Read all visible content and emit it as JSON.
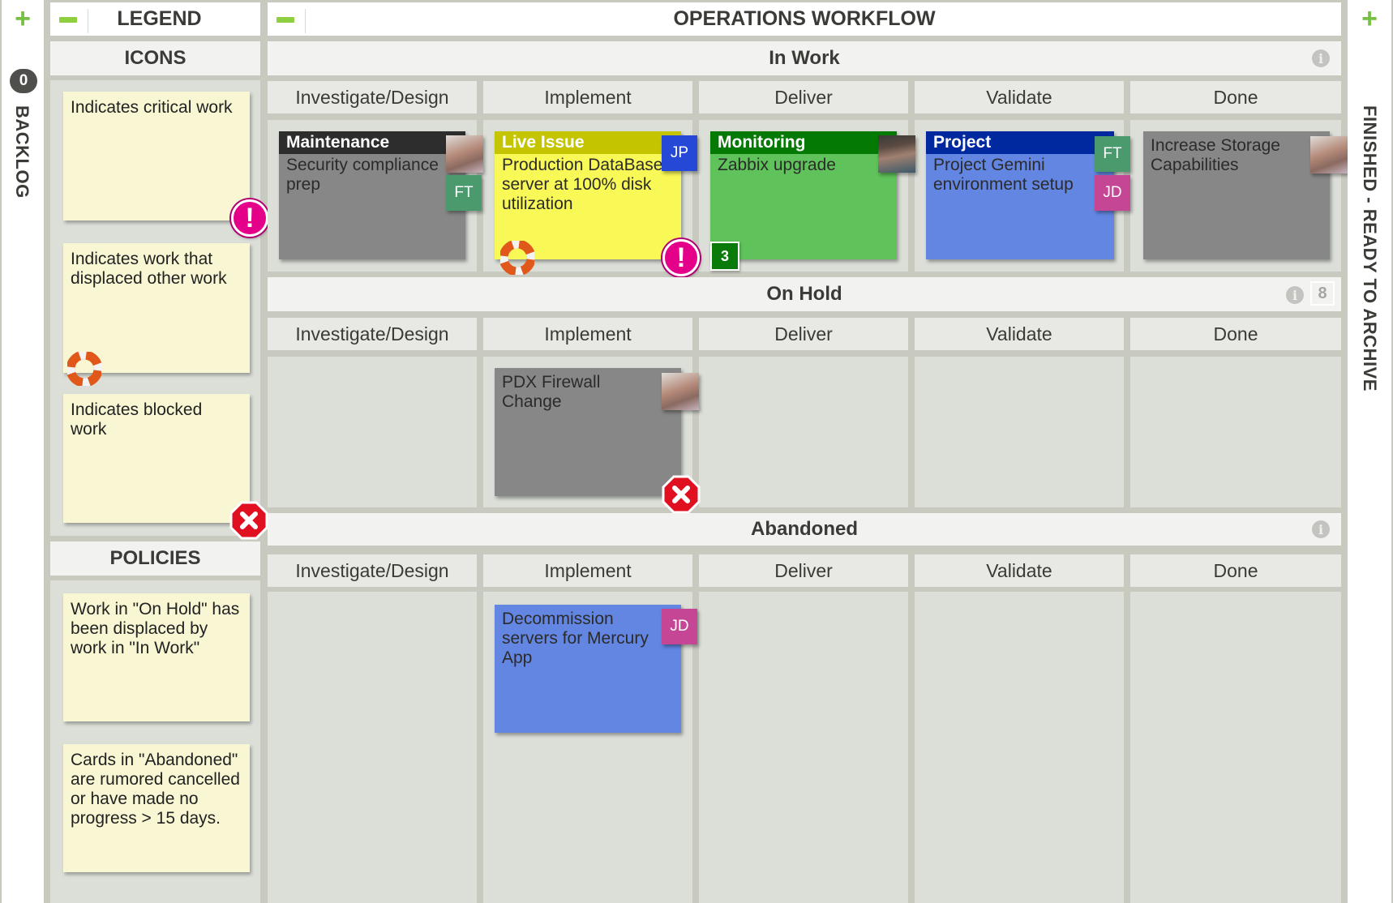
{
  "backlog": {
    "label": "BACKLOG",
    "count": "0",
    "add_icon": "+"
  },
  "finished": {
    "label": "FINISHED - READY TO ARCHIVE",
    "add_icon": "+"
  },
  "legend": {
    "title": "LEGEND",
    "icons_title": "ICONS",
    "icons": [
      {
        "text": "Indicates critical work",
        "icon": "critical-icon"
      },
      {
        "text": "Indicates work that displaced other work",
        "icon": "lifebuoy-icon"
      },
      {
        "text": "Indicates blocked work",
        "icon": "blocked-icon"
      }
    ],
    "policies_title": "POLICIES",
    "policies": [
      {
        "text": "Work in \"On Hold\" has been displaced by work in \"In Work\""
      },
      {
        "text": "Cards in \"Abandoned\" are rumored cancelled or have made no progress > 15 days."
      }
    ]
  },
  "board": {
    "title": "OPERATIONS WORKFLOW",
    "columns": [
      "Investigate/Design",
      "Implement",
      "Deliver",
      "Validate",
      "Done"
    ],
    "lanes": [
      {
        "name": "In Work",
        "wip_limit": null
      },
      {
        "name": "On Hold",
        "wip_limit": "8"
      },
      {
        "name": "Abandoned",
        "wip_limit": null
      }
    ]
  },
  "cards": {
    "maintenance": {
      "type": "Maintenance",
      "title": "Security compliance prep",
      "assignees": [
        "FT"
      ],
      "has_avatar": true,
      "critical": true
    },
    "live_issue": {
      "type": "Live Issue",
      "title": "Production DataBase server at 100% disk utilization",
      "assignees": [
        "JP"
      ],
      "critical": true,
      "displaced_other_work": true
    },
    "monitoring": {
      "type": "Monitoring",
      "title": "Zabbix upgrade",
      "has_avatar": true,
      "count": "3"
    },
    "project": {
      "type": "Project",
      "title": "Project Gemini environment setup",
      "assignees": [
        "FT",
        "JD"
      ]
    },
    "storage": {
      "type": "",
      "title": "Increase Storage Capabilities",
      "has_avatar": true
    },
    "firewall": {
      "type": "",
      "title": "PDX Firewall Change",
      "has_avatar": true,
      "blocked": true
    },
    "decommission": {
      "type": "",
      "title": "Decommission servers for Mercury App",
      "assignees": [
        "JD"
      ]
    }
  },
  "colors": {
    "maintenance_header": "#2d2d2d",
    "gray_card": "#878787",
    "live_issue_header": "#c4c400",
    "live_issue_body": "#f8f857",
    "monitoring_header": "#047a04",
    "monitoring_body": "#5fc25a",
    "project_header": "#0029a0",
    "project_body": "#6386e2",
    "badge_FT": "#4a9a6e",
    "badge_JP": "#2648d6",
    "badge_JD": "#c54695",
    "accent_green": "#76c043"
  }
}
